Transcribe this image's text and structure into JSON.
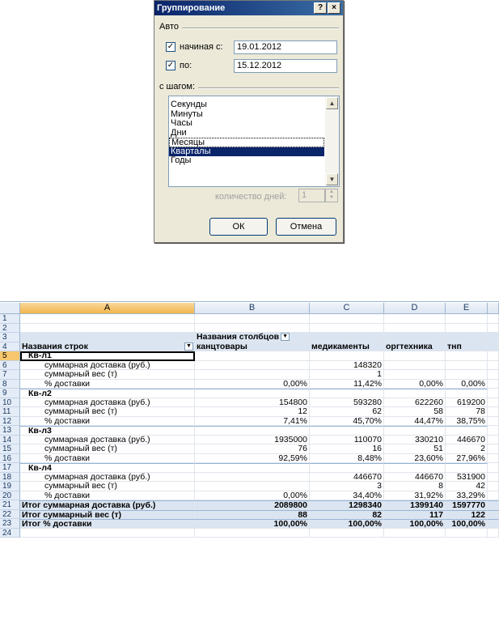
{
  "dialog": {
    "title": "Группирование",
    "help_btn": "?",
    "close_btn": "×",
    "auto_label": "Авто",
    "start": {
      "checked_mark": "✓",
      "label": "начиная с:",
      "value": "19.01.2012"
    },
    "end": {
      "checked_mark": "✓",
      "label": "по:",
      "value": "15.12.2012"
    },
    "step_label": "с шагом:",
    "step_options": [
      "Секунды",
      "Минуты",
      "Часы",
      "Дни",
      "Месяцы",
      "Кварталы",
      "Годы"
    ],
    "focused_option": "Месяцы",
    "selected_option": "Кварталы",
    "days_label": "количество дней:",
    "days_value": "1",
    "ok": "ОК",
    "cancel": "Отмена"
  },
  "sheet": {
    "columns": [
      "A",
      "B",
      "C",
      "D",
      "E"
    ],
    "active_column": "A",
    "active_row": "5",
    "rows": [
      {
        "n": "1",
        "a": "",
        "b": "",
        "c": "",
        "d": "",
        "e": ""
      },
      {
        "n": "2",
        "a": "",
        "b": "",
        "c": "",
        "d": "",
        "e": ""
      },
      {
        "n": "3",
        "a": "",
        "b": "Названия столбцов",
        "c": "",
        "d": "",
        "e": ""
      },
      {
        "n": "4",
        "a": "Названия строк",
        "b": "канцтовары",
        "c": "медикаменты",
        "d": "оргтехника",
        "e": "тнп"
      },
      {
        "n": "5",
        "a": "Кв-л1",
        "b": "",
        "c": "",
        "d": "",
        "e": ""
      },
      {
        "n": "6",
        "a": "суммарная доставка (руб.)",
        "b": "",
        "c": "148320",
        "d": "",
        "e": ""
      },
      {
        "n": "7",
        "a": "суммарный вес (т)",
        "b": "",
        "c": "1",
        "d": "",
        "e": ""
      },
      {
        "n": "8",
        "a": "% доставки",
        "b": "0,00%",
        "c": "11,42%",
        "d": "0,00%",
        "e": "0,00%"
      },
      {
        "n": "9",
        "a": "Кв-л2",
        "b": "",
        "c": "",
        "d": "",
        "e": ""
      },
      {
        "n": "10",
        "a": "суммарная доставка (руб.)",
        "b": "154800",
        "c": "593280",
        "d": "622260",
        "e": "619200"
      },
      {
        "n": "11",
        "a": "суммарный вес (т)",
        "b": "12",
        "c": "62",
        "d": "58",
        "e": "78"
      },
      {
        "n": "12",
        "a": "% доставки",
        "b": "7,41%",
        "c": "45,70%",
        "d": "44,47%",
        "e": "38,75%"
      },
      {
        "n": "13",
        "a": "Кв-л3",
        "b": "",
        "c": "",
        "d": "",
        "e": ""
      },
      {
        "n": "14",
        "a": "суммарная доставка (руб.)",
        "b": "1935000",
        "c": "110070",
        "d": "330210",
        "e": "446670"
      },
      {
        "n": "15",
        "a": "суммарный вес (т)",
        "b": "76",
        "c": "16",
        "d": "51",
        "e": "2"
      },
      {
        "n": "16",
        "a": "% доставки",
        "b": "92,59%",
        "c": "8,48%",
        "d": "23,60%",
        "e": "27,96%"
      },
      {
        "n": "17",
        "a": "Кв-л4",
        "b": "",
        "c": "",
        "d": "",
        "e": ""
      },
      {
        "n": "18",
        "a": "суммарная доставка (руб.)",
        "b": "",
        "c": "446670",
        "d": "446670",
        "e": "531900"
      },
      {
        "n": "19",
        "a": "суммарный вес (т)",
        "b": "",
        "c": "3",
        "d": "8",
        "e": "42"
      },
      {
        "n": "20",
        "a": "% доставки",
        "b": "0,00%",
        "c": "34,40%",
        "d": "31,92%",
        "e": "33,29%"
      },
      {
        "n": "21",
        "a": "Итог суммарная доставка (руб.)",
        "b": "2089800",
        "c": "1298340",
        "d": "1399140",
        "e": "1597770"
      },
      {
        "n": "22",
        "a": "Итог суммарный вес (т)",
        "b": "88",
        "c": "82",
        "d": "117",
        "e": "122"
      },
      {
        "n": "23",
        "a": "Итог % доставки",
        "b": "100,00%",
        "c": "100,00%",
        "d": "100,00%",
        "e": "100,00%"
      },
      {
        "n": "24",
        "a": "",
        "b": "",
        "c": "",
        "d": "",
        "e": ""
      }
    ]
  }
}
